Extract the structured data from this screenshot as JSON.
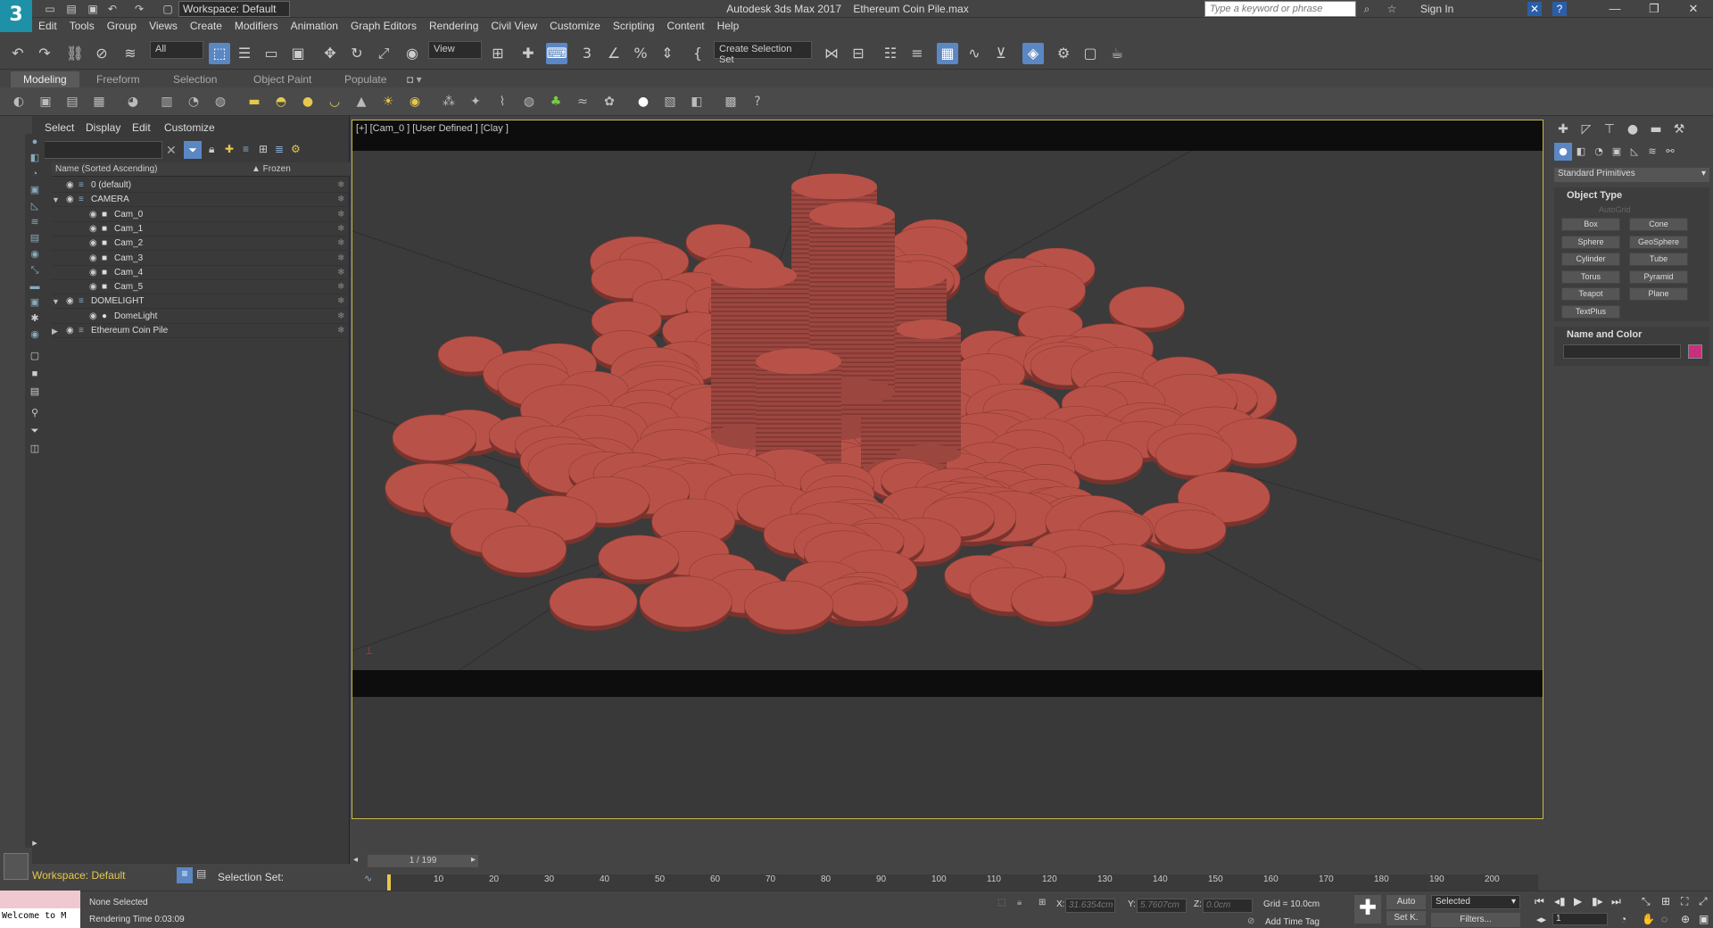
{
  "app": {
    "title": "Autodesk 3ds Max 2017",
    "file": "Ethereum Coin Pile.max",
    "workspace": "Workspace: Default",
    "search_placeholder": "Type a keyword or phrase",
    "signin": "Sign In"
  },
  "menu": [
    "Edit",
    "Tools",
    "Group",
    "Views",
    "Create",
    "Modifiers",
    "Animation",
    "Graph Editors",
    "Rendering",
    "Civil View",
    "Customize",
    "Scripting",
    "Content",
    "Help"
  ],
  "toolbar": {
    "filter": "All",
    "refcoord": "View",
    "selection_set": "Create Selection Set"
  },
  "ribbon_tabs": [
    "Modeling",
    "Freeform",
    "Selection",
    "Object Paint",
    "Populate"
  ],
  "explorer": {
    "menu": [
      "Select",
      "Display",
      "Edit",
      "Customize"
    ],
    "col_name": "Name (Sorted Ascending)",
    "col_frozen": "▲ Frozen",
    "rows": [
      {
        "label": "0 (default)",
        "indent": 0
      },
      {
        "label": "CAMERA",
        "indent": 0
      },
      {
        "label": "Cam_0",
        "indent": 1
      },
      {
        "label": "Cam_1",
        "indent": 1
      },
      {
        "label": "Cam_2",
        "indent": 1
      },
      {
        "label": "Cam_3",
        "indent": 1
      },
      {
        "label": "Cam_4",
        "indent": 1
      },
      {
        "label": "Cam_5",
        "indent": 1
      },
      {
        "label": "DOMELIGHT",
        "indent": 0
      },
      {
        "label": "DomeLight",
        "indent": 1
      },
      {
        "label": "Ethereum Coin Pile",
        "indent": 0
      }
    ],
    "selection_set_label": "Selection Set:"
  },
  "viewport": {
    "label": "[+] [Cam_0 ] [User Defined ] [Clay ]"
  },
  "command_panel": {
    "category": "Standard Primitives",
    "object_type_title": "Object Type",
    "autogrid": "AutoGrid",
    "buttons": [
      "Box",
      "Cone",
      "Sphere",
      "GeoSphere",
      "Cylinder",
      "Tube",
      "Torus",
      "Pyramid",
      "Teapot",
      "Plane",
      "TextPlus"
    ],
    "name_color_title": "Name and Color",
    "color": "#c8307a"
  },
  "timeline": {
    "frame": "1 / 199",
    "ticks": [
      "10",
      "20",
      "30",
      "40",
      "50",
      "60",
      "70",
      "80",
      "90",
      "100",
      "110",
      "120",
      "130",
      "140",
      "150",
      "160",
      "170",
      "180",
      "190",
      "200"
    ]
  },
  "status": {
    "selection": "None Selected",
    "render_time": "Rendering Time  0:03:09",
    "welcome": "Welcome to M",
    "x_label": "X:",
    "x_value": "31.6354cm",
    "y_label": "Y:",
    "y_value": "5.7607cm",
    "z_label": "Z:",
    "z_value": "0.0cm",
    "grid": "Grid = 10.0cm",
    "add_time_tag": "Add Time Tag",
    "auto": "Auto",
    "selected": "Selected",
    "setk": "Set K.",
    "filters": "Filters...",
    "frame_field": "1"
  },
  "coin_color": "#b85248"
}
